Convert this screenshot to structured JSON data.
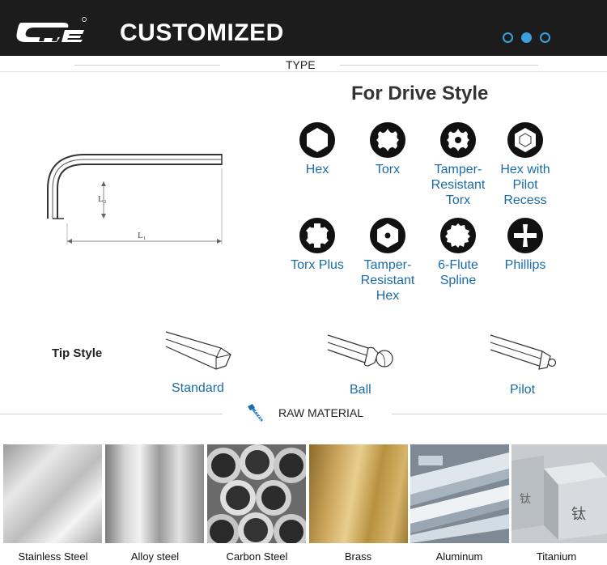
{
  "header": {
    "title": "CUSTOMIZED",
    "logo_text": "CHE",
    "carousel": {
      "count": 3,
      "active_index": 1
    }
  },
  "type_section": {
    "label": "TYPE"
  },
  "diagram": {
    "l2_label": "L₂",
    "l1_label": "L₁"
  },
  "drive_style": {
    "title": "For Drive Style",
    "items": [
      {
        "label": "Hex",
        "icon": "hex-socket-icon"
      },
      {
        "label": "Torx",
        "icon": "torx-icon"
      },
      {
        "label": "Tamper-\nResistant\nTorx",
        "icon": "tamper-resistant-torx-icon"
      },
      {
        "label": "Hex with\nPilot\nRecess",
        "icon": "hex-pilot-recess-icon"
      },
      {
        "label": "Torx Plus",
        "icon": "torx-plus-icon"
      },
      {
        "label": "Tamper-\nResistant\nHex",
        "icon": "tamper-resistant-hex-icon"
      },
      {
        "label": "6-Flute\nSpline",
        "icon": "six-flute-spline-icon"
      },
      {
        "label": "Phillips",
        "icon": "phillips-icon"
      }
    ]
  },
  "tip_style": {
    "heading": "Tip Style",
    "items": [
      {
        "label": "Standard"
      },
      {
        "label": "Ball"
      },
      {
        "label": "Pilot"
      }
    ]
  },
  "raw_material": {
    "label": "RAW MATERIAL",
    "icon": "screw-icon",
    "items": [
      {
        "label": "Stainless Steel"
      },
      {
        "label": "Alloy steel"
      },
      {
        "label": "Carbon Steel"
      },
      {
        "label": "Brass"
      },
      {
        "label": "Aluminum"
      },
      {
        "label": "Titanium"
      }
    ]
  },
  "colors": {
    "accent": "#1a6ca8",
    "header_bg": "#1c1c1c",
    "dot": "#3aa0e0"
  }
}
